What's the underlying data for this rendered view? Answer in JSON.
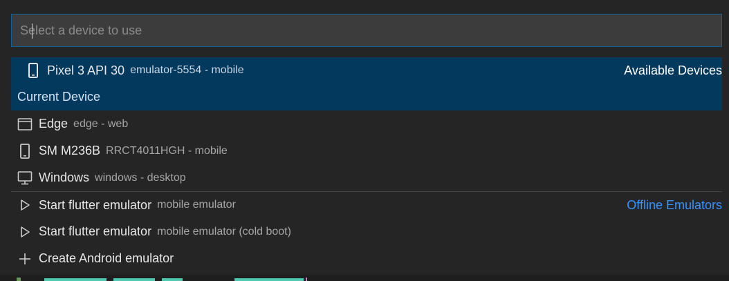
{
  "search": {
    "placeholder": "Select a device to use",
    "value": ""
  },
  "items": [
    {
      "icon": "mobile-phone-icon",
      "label": "Pixel 3 API 30",
      "description": "emulator-5554 - mobile",
      "detail": "Current Device",
      "group": "Available Devices",
      "selected": true
    },
    {
      "icon": "browser-window-icon",
      "label": "Edge",
      "description": "edge - web"
    },
    {
      "icon": "mobile-phone-icon",
      "label": "SM M236B",
      "description": "RRCT4011HGH - mobile"
    },
    {
      "icon": "desktop-monitor-icon",
      "label": "Windows",
      "description": "windows - desktop"
    },
    {
      "icon": "play-icon",
      "label": "Start flutter emulator",
      "description": "mobile emulator",
      "group": "Offline Emulators"
    },
    {
      "icon": "play-icon",
      "label": "Start flutter emulator",
      "description": "mobile emulator (cold boot)"
    },
    {
      "icon": "plus-icon",
      "label": "Create Android emulator",
      "description": ""
    }
  ],
  "colors": {
    "accent": "#3794ff",
    "selection": "#04395e",
    "focus_border": "#0e639c"
  }
}
